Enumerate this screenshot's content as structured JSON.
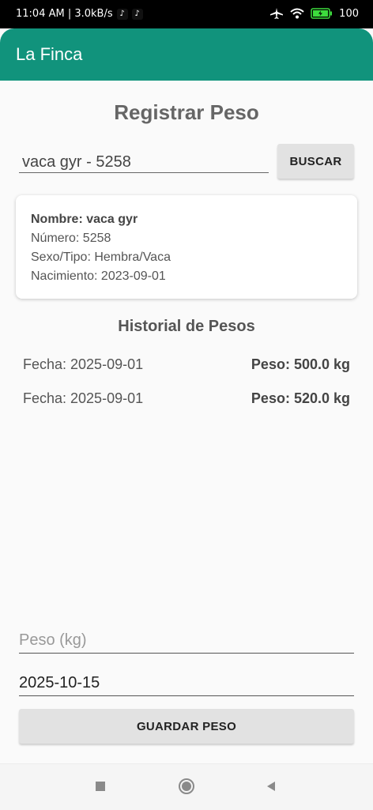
{
  "status_bar": {
    "time_speed": "11:04 AM | 3.0kB/s",
    "battery": "100"
  },
  "app": {
    "title": "La Finca"
  },
  "page": {
    "title": "Registrar Peso"
  },
  "search": {
    "value": "vaca gyr - 5258",
    "button_label": "BUSCAR"
  },
  "animal_card": {
    "name": "Nombre: vaca gyr",
    "number": "Número: 5258",
    "sex_type": "Sexo/Tipo: Hembra/Vaca",
    "birth": "Nacimiento: 2023-09-01"
  },
  "history": {
    "title": "Historial de Pesos",
    "rows": [
      {
        "date": "Fecha: 2025-09-01",
        "weight": "Peso: 500.0 kg"
      },
      {
        "date": "Fecha: 2025-09-01",
        "weight": "Peso: 520.0 kg"
      }
    ]
  },
  "form": {
    "weight_placeholder": "Peso (kg)",
    "weight_value": "",
    "date_value": "2025-10-15",
    "save_label": "GUARDAR PESO"
  },
  "icons": {
    "airplane": "airplane-icon",
    "wifi": "wifi-icon",
    "battery": "battery-charging-icon",
    "nav_recent": "square-icon",
    "nav_home": "circle-icon",
    "nav_back": "triangle-back-icon"
  },
  "colors": {
    "accent": "#11937c",
    "status_bar": "#000000"
  }
}
